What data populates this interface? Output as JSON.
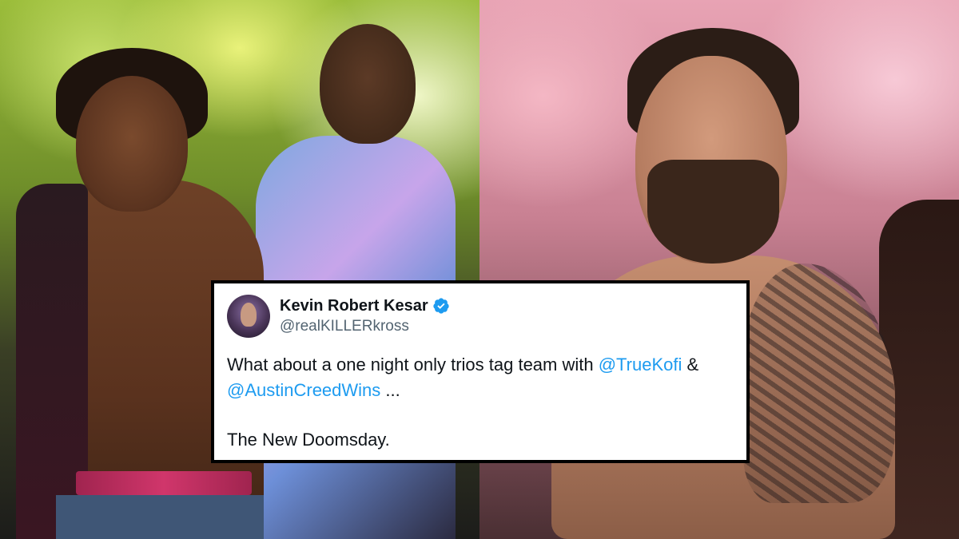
{
  "tweet": {
    "display_name": "Kevin Robert Kesar",
    "handle": "@realKILLERkross",
    "verified": true,
    "line1_prefix": "What about a one night only trios tag team with ",
    "mention1": "@TrueKofi",
    "line1_suffix": " &",
    "mention2": "@AustinCreedWins",
    "line2_suffix": " ...",
    "line3": "The New Doomsday."
  },
  "colors": {
    "mention": "#1d9bf0",
    "verified": "#1d9bf0",
    "text": "#0f1419",
    "handle": "#536471",
    "card_border": "#000000"
  },
  "icons": {
    "verified": "verified-badge-icon",
    "avatar": "profile-avatar"
  }
}
